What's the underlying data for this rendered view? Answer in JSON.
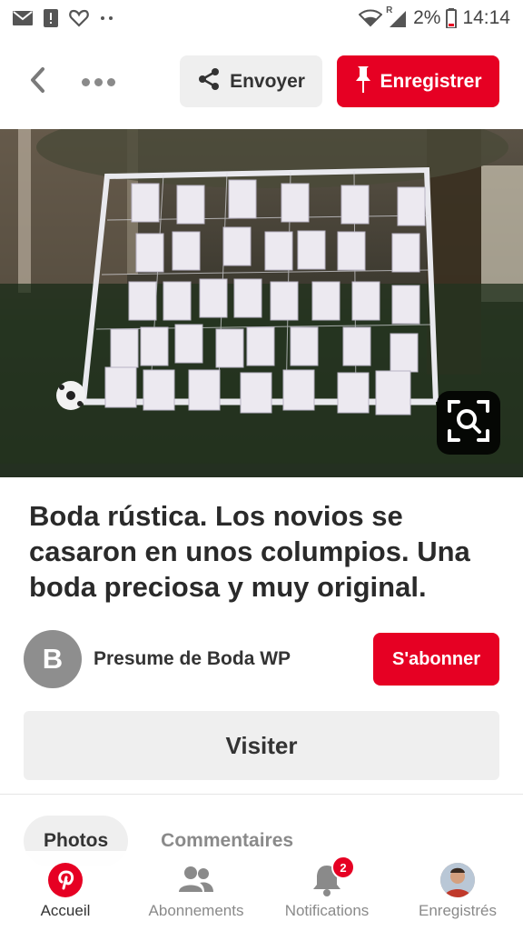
{
  "status_bar": {
    "battery_percent": "2%",
    "time": "14:14",
    "signal_letter": "R",
    "left_icons": [
      "mail-icon",
      "alert-icon",
      "heart-icon",
      "dots-icon"
    ],
    "right_icons": [
      "wifi-icon",
      "signal-icon",
      "battery-icon"
    ]
  },
  "toolbar": {
    "send_label": "Envoyer",
    "save_label": "Enregistrer",
    "icons": [
      "back-icon",
      "more-icon",
      "share-icon",
      "pin-icon"
    ]
  },
  "pin": {
    "title": "Boda rústica. Los novios se casaron en unos columpios. Una boda preciosa y muy original."
  },
  "creator": {
    "initial": "B",
    "name": "Presume de Boda WP",
    "follow_label": "S'abonner"
  },
  "visit_label": "Visiter",
  "tabs": [
    {
      "label": "Photos",
      "active": true
    },
    {
      "label": "Commentaires",
      "active": false
    }
  ],
  "bottom_nav": {
    "items": [
      {
        "label": "Accueil",
        "icon": "pinterest-icon",
        "active": true
      },
      {
        "label": "Abonnements",
        "icon": "people-icon",
        "active": false
      },
      {
        "label": "Notifications",
        "icon": "bell-icon",
        "active": false,
        "badge": "2"
      },
      {
        "label": "Enregistrés",
        "icon": "profile-icon",
        "active": false
      }
    ]
  },
  "colors": {
    "accent": "#e60023",
    "button_grey": "#efefef"
  }
}
